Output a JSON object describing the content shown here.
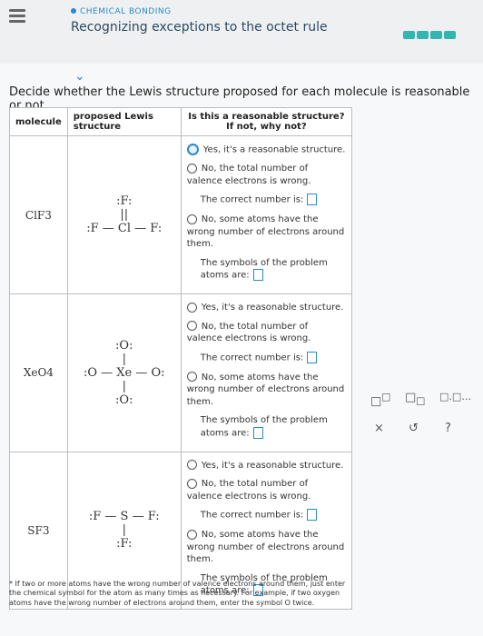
{
  "header": {
    "topic": "CHEMICAL BONDING",
    "title": "Recognizing exceptions to the octet rule"
  },
  "prompt": "Decide whether the Lewis structure proposed for each molecule is reasonable or not.",
  "table": {
    "headers": [
      "molecule",
      "proposed Lewis structure",
      "Is this a reasonable structure? If not, why not?"
    ],
    "rows": [
      {
        "molecule": "ClF3",
        "lewis": [
          ":F:",
          "||",
          ":F — Cl — F:"
        ],
        "options": [
          "Yes, it's a reasonable structure.",
          "No, the total number of valence electrons is wrong.",
          "The correct number is:",
          "No, some atoms have the wrong number of electrons around them.",
          "The symbols of the problem atoms are:"
        ]
      },
      {
        "molecule": "XeO4",
        "lewis": [
          ":O:",
          "|",
          ":O — Xe — O:",
          "|",
          ":O:"
        ],
        "options": [
          "Yes, it's a reasonable structure.",
          "No, the total number of valence electrons is wrong.",
          "The correct number is:",
          "No, some atoms have the wrong number of electrons around them.",
          "The symbols of the problem atoms are:"
        ]
      },
      {
        "molecule": "SF3",
        "lewis": [
          ":F — S — F:",
          "|",
          ":F:"
        ],
        "options": [
          "Yes, it's a reasonable structure.",
          "No, the total number of valence electrons is wrong.",
          "The correct number is:",
          "No, some atoms have the wrong number of electrons around them.",
          "The symbols of the problem atoms are:"
        ]
      }
    ]
  },
  "note": "* If two or more atoms have the wrong number of valence electrons around them, just enter the chemical symbol for the atom as many times as necessary. For example, if two oxygen atoms have the wrong number of electrons around them, enter the symbol O twice.",
  "toolbar": {
    "close": "×",
    "undo": "↺",
    "help": "?"
  }
}
